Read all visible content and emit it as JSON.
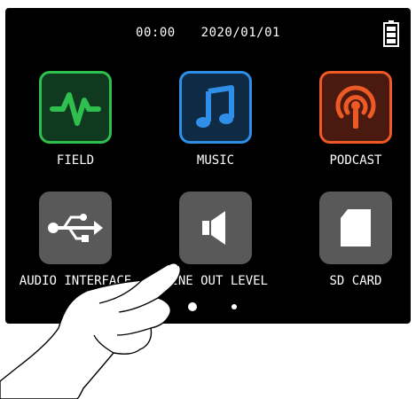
{
  "status_bar": {
    "time": "00:00",
    "date": "2020/01/01",
    "battery_icon": "battery-full-icon"
  },
  "apps": [
    {
      "label": "FIELD",
      "icon": "waveform-icon",
      "border_color": "#2fbf4f",
      "bg_color": "#0f3a1f",
      "glyph_color": "#2fbf4f"
    },
    {
      "label": "MUSIC",
      "icon": "music-note-icon",
      "border_color": "#2f8fe8",
      "bg_color": "#0f2a44",
      "glyph_color": "#2f8fe8"
    },
    {
      "label": "PODCAST",
      "icon": "podcast-icon",
      "border_color": "#ee5a26",
      "bg_color": "#4a1a10",
      "glyph_color": "#ee5a26"
    },
    {
      "label": "AUDIO INTERFACE",
      "icon": "usb-icon",
      "border_color": "#666666",
      "bg_color": "#595959",
      "glyph_color": "#ffffff"
    },
    {
      "label": "LINE OUT LEVEL",
      "icon": "speaker-icon",
      "border_color": "#666666",
      "bg_color": "#595959",
      "glyph_color": "#ffffff"
    },
    {
      "label": "SD CARD",
      "icon": "sd-card-icon",
      "border_color": "#666666",
      "bg_color": "#595959",
      "glyph_color": "#ffffff"
    }
  ],
  "pagination": {
    "current_page": 1,
    "total_pages": 2
  }
}
